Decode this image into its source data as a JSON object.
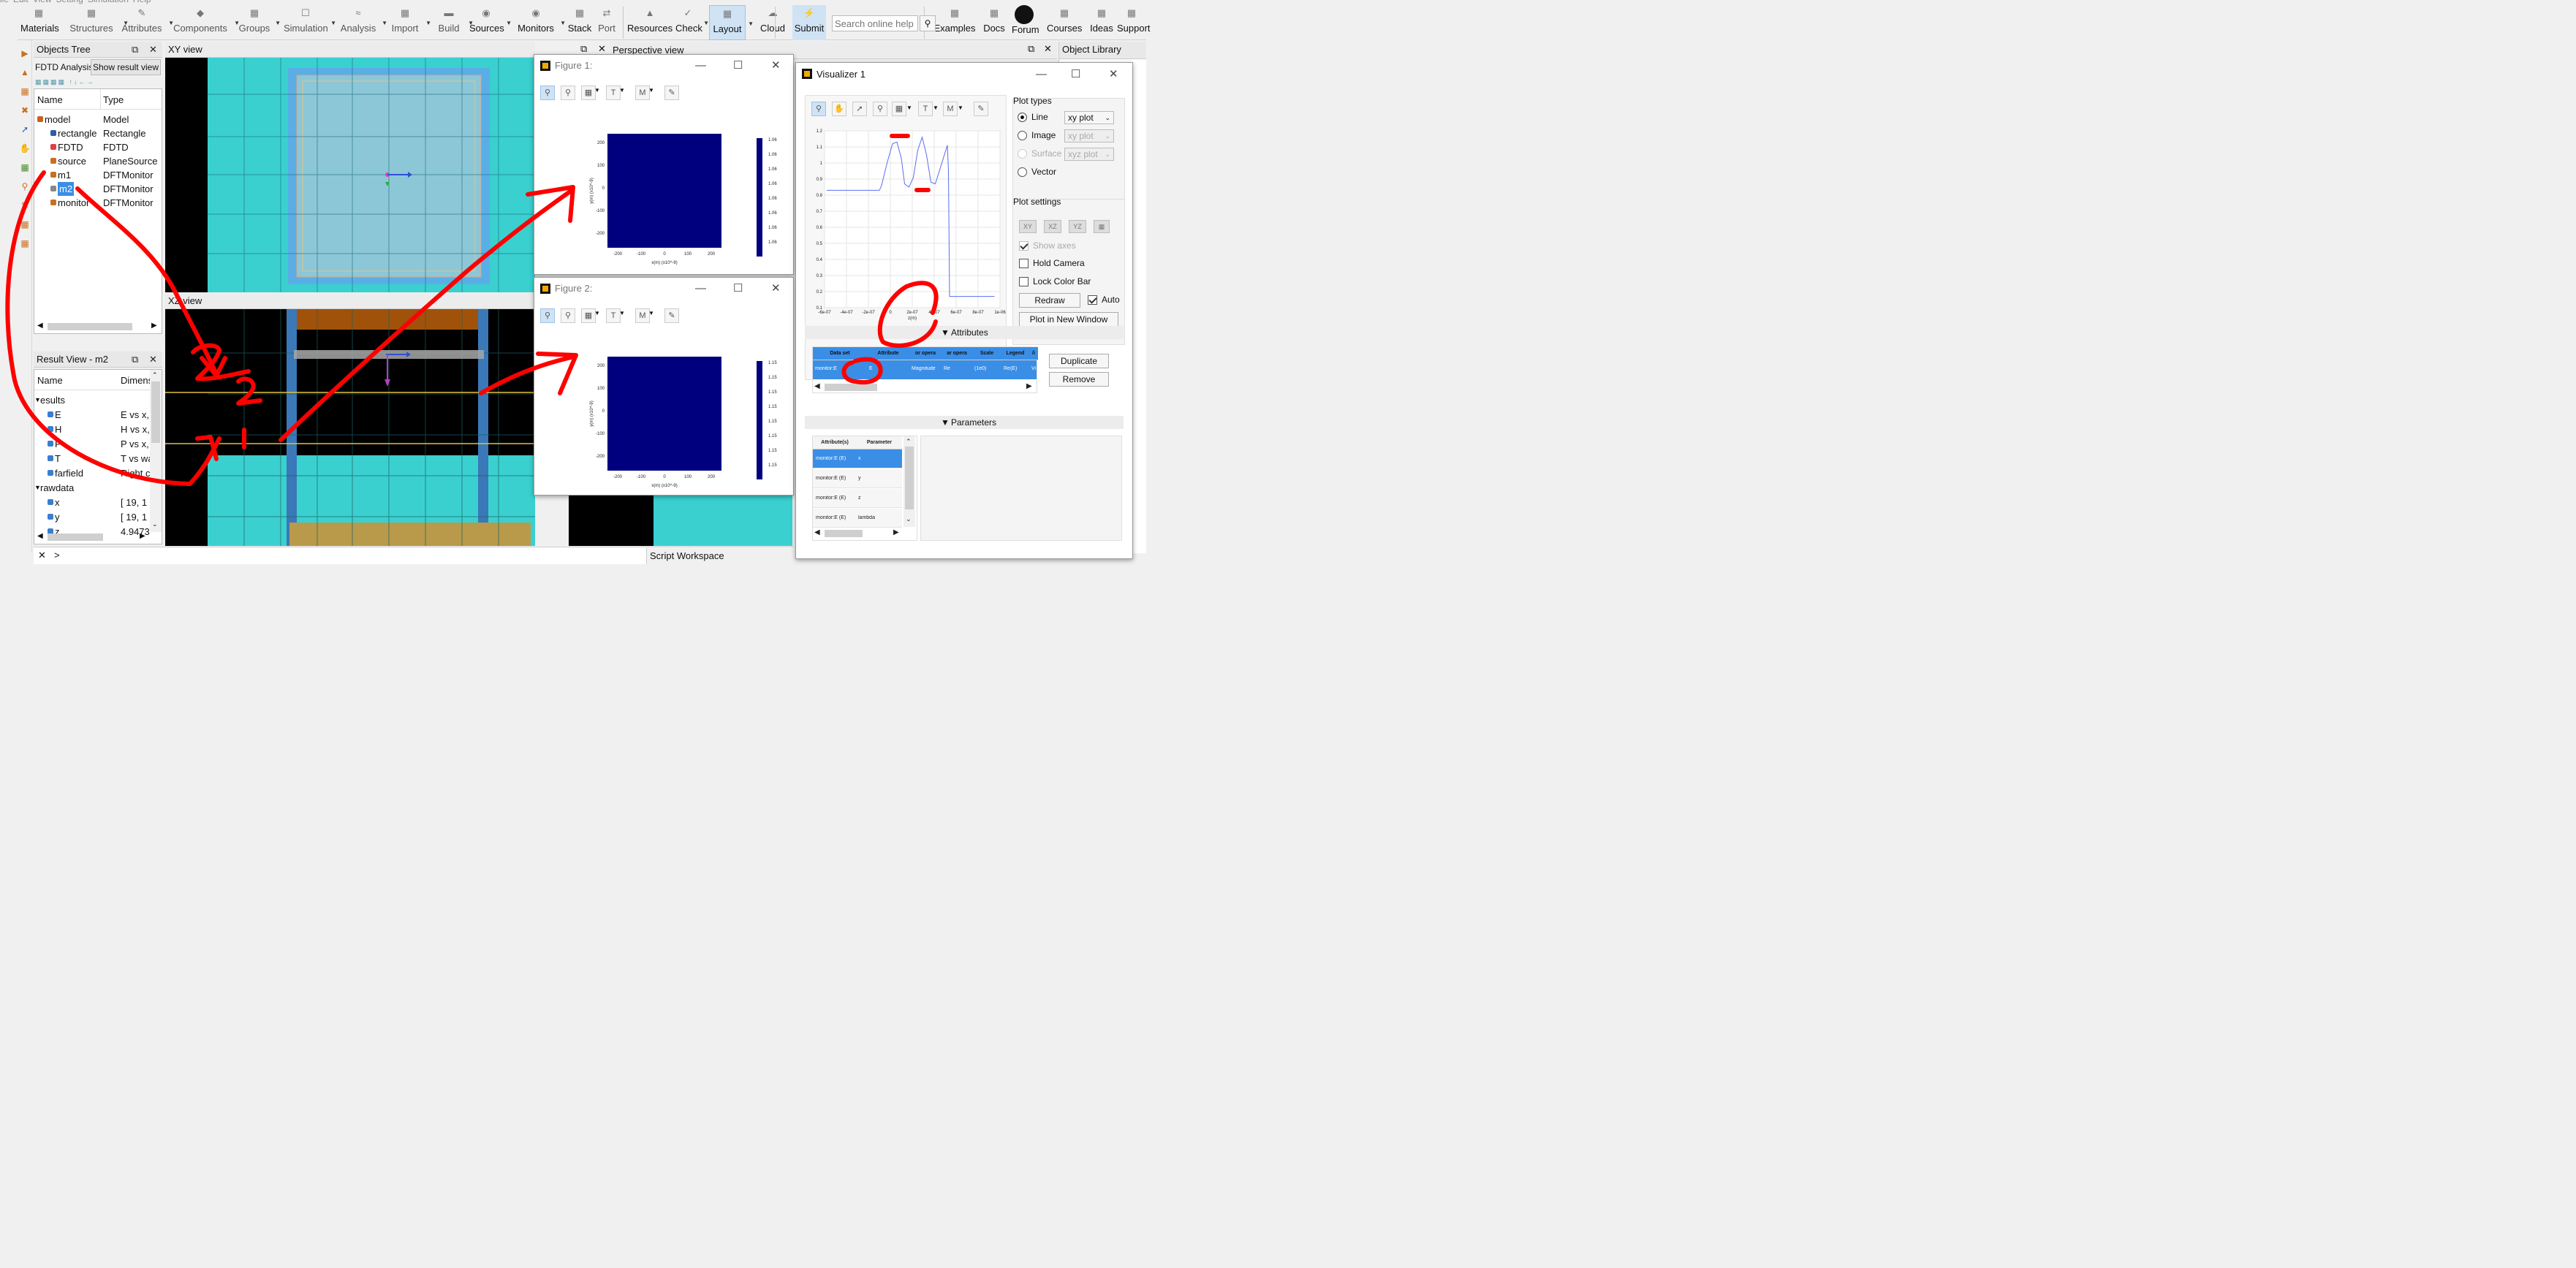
{
  "menubar": {
    "items": [
      "ile",
      "Edit",
      "View",
      "Setting",
      "Simulation",
      "Help"
    ]
  },
  "toolbar": {
    "items": [
      {
        "label": "Materials",
        "icon": "materials-icon"
      },
      {
        "label": "Structures",
        "icon": "structures-icon"
      },
      {
        "label": "Attributes",
        "icon": "attributes-icon"
      },
      {
        "label": "Components",
        "icon": "components-icon"
      },
      {
        "label": "Groups",
        "icon": "groups-icon"
      },
      {
        "label": "Simulation",
        "icon": "simulation-icon"
      },
      {
        "label": "Analysis",
        "icon": "analysis-icon"
      },
      {
        "label": "Import",
        "icon": "import-icon"
      },
      {
        "label": "Build",
        "icon": "build-icon"
      },
      {
        "label": "Sources",
        "icon": "sources-icon"
      },
      {
        "label": "Monitors",
        "icon": "monitors-icon"
      },
      {
        "label": "Stack",
        "icon": "stack-icon"
      },
      {
        "label": "Port",
        "icon": "port-icon"
      },
      {
        "label": "Resources",
        "icon": "resources-icon"
      },
      {
        "label": "Check",
        "icon": "check-icon"
      },
      {
        "label": "Layout",
        "icon": "layout-icon"
      },
      {
        "label": "Cloud",
        "icon": "cloud-icon"
      },
      {
        "label": "Submit",
        "icon": "submit-icon"
      },
      {
        "label": "Examples",
        "icon": "examples-icon"
      },
      {
        "label": "Docs",
        "icon": "docs-icon"
      },
      {
        "label": "Forum",
        "icon": "forum-icon"
      },
      {
        "label": "Courses",
        "icon": "courses-icon"
      },
      {
        "label": "Ideas",
        "icon": "ideas-icon"
      },
      {
        "label": "Support",
        "icon": "support-icon"
      }
    ],
    "search_placeholder": "Search online help"
  },
  "objects_tree": {
    "title": "Objects Tree",
    "tab_active": "FDTD Analysis",
    "tab_other": "Show result view",
    "col_name": "Name",
    "col_type": "Type",
    "rows": [
      {
        "name": "model",
        "type": "Model"
      },
      {
        "name": "rectangle",
        "type": "Rectangle"
      },
      {
        "name": "FDTD",
        "type": "FDTD"
      },
      {
        "name": "source",
        "type": "PlaneSource"
      },
      {
        "name": "m1",
        "type": "DFTMonitor"
      },
      {
        "name": "m2",
        "type": "DFTMonitor"
      },
      {
        "name": "monitor",
        "type": "DFTMonitor"
      }
    ]
  },
  "result_view": {
    "title": "Result View - m2",
    "col_name": "Name",
    "col_dims": "Dimens",
    "rows": [
      {
        "name": "esults",
        "dims": ""
      },
      {
        "name": "E",
        "dims": "E vs x,"
      },
      {
        "name": "H",
        "dims": "H vs x,"
      },
      {
        "name": "P",
        "dims": "P vs x,"
      },
      {
        "name": "T",
        "dims": "T vs wa"
      },
      {
        "name": "farfield",
        "dims": "Right c"
      },
      {
        "name": "rawdata",
        "dims": ""
      },
      {
        "name": "x",
        "dims": "[ 19, 1"
      },
      {
        "name": "y",
        "dims": "[ 19, 1"
      },
      {
        "name": "z",
        "dims": "4.9473"
      }
    ]
  },
  "views": {
    "xy": "XY view",
    "xz": "XZ view",
    "perspective": "Perspective view",
    "object_library": "Object Library",
    "script_workspace": "Script Workspace",
    "prompt": ">"
  },
  "annotations": {
    "label_1": "1",
    "label_2": "2"
  },
  "figure1": {
    "title": "Figure 1:",
    "xlabel": "x(m) (x10^-9)",
    "ylabel": "y(m) (x10^-9)",
    "xticks": [
      "-200",
      "-100",
      "0",
      "100",
      "200"
    ],
    "yticks": [
      "200",
      "100",
      "0",
      "-100",
      "-200"
    ],
    "cbar": [
      "1.06",
      "1.06",
      "1.06",
      "1.06",
      "1.06",
      "1.06",
      "1.06",
      "1.06"
    ]
  },
  "figure2": {
    "title": "Figure 2:",
    "xlabel": "x(m) (x10^-9)",
    "ylabel": "y(m) (x10^-9)",
    "xticks": [
      "-200",
      "-100",
      "0",
      "100",
      "200"
    ],
    "yticks": [
      "200",
      "100",
      "0",
      "-100",
      "-200"
    ],
    "cbar": [
      "1.15",
      "1.15",
      "1.15",
      "1.15",
      "1.15",
      "1.15",
      "1.15",
      "1.15"
    ]
  },
  "visualizer": {
    "title": "Visualizer 1",
    "plot_types_label": "Plot types",
    "types": [
      {
        "label": "Line",
        "select": "xy plot",
        "checked": true,
        "enabled": true
      },
      {
        "label": "Image",
        "select": "xy plot",
        "checked": false,
        "enabled": true
      },
      {
        "label": "Surface",
        "select": "xyz plot",
        "checked": false,
        "enabled": false
      },
      {
        "label": "Vector",
        "select": "",
        "checked": false,
        "enabled": true
      }
    ],
    "plot_settings_label": "Plot settings",
    "view_buttons": [
      "XY",
      "XZ",
      "YZ"
    ],
    "show_axes": "Show axes",
    "hold_camera": "Hold Camera",
    "lock_color_bar": "Lock Color Bar",
    "redraw": "Redraw",
    "auto": "Auto",
    "plot_new_window": "Plot in New Window",
    "attributes_label": "Attributes",
    "parameters_label": "Parameters",
    "duplicate": "Duplicate",
    "remove": "Remove",
    "attr_headers": [
      "Data set",
      "Attribute",
      "or opera",
      "ar opera",
      "Scale",
      "Legend",
      "/i"
    ],
    "attr_row": [
      "monitor:E",
      "E",
      "Magnitude",
      "Re",
      "(1e0)",
      "Re(E)",
      "Vi D"
    ],
    "param_headers": [
      "Attribute(s)",
      "Parameter"
    ],
    "param_rows": [
      [
        "monitor:E (E)",
        "x"
      ],
      [
        "monitor:E (E)",
        "y"
      ],
      [
        "monitor:E (E)",
        "z"
      ],
      [
        "monitor:E (E)",
        "lambda"
      ]
    ]
  },
  "chart_data": {
    "type": "line",
    "xlabel": "z(m)",
    "xticks": [
      "-6e-07",
      "-4e-07",
      "-2e-07",
      "0",
      "2e-07",
      "4e-07",
      "6e-07",
      "8e-07",
      "1e-06"
    ],
    "yticks": [
      "1.2",
      "1.1",
      "1",
      "0.9",
      "0.8",
      "0.7",
      "0.6",
      "0.5",
      "0.4",
      "0.3",
      "0.2",
      "0.1"
    ],
    "xlim": [
      -6e-07,
      1e-06
    ],
    "ylim": [
      0.1,
      1.2
    ],
    "series": [
      {
        "x": [
          -5.8e-07,
          -1e-07,
          -8e-08,
          -3e-08,
          2e-08,
          6e-08,
          1e-07,
          1.3e-07,
          1.7e-07,
          2.1e-07,
          2.5e-07,
          2.9e-07,
          3.3e-07,
          3.7e-07,
          4.1e-07,
          5.2e-07,
          5.3e-07,
          5.4e-07,
          5.7e-07,
          5.8e-07,
          8e-07,
          9.5e-07
        ],
        "y": [
          0.83,
          0.83,
          0.86,
          1.0,
          1.12,
          1.13,
          1.03,
          0.87,
          0.85,
          0.91,
          1.08,
          1.16,
          1.05,
          0.88,
          0.87,
          1.11,
          0.95,
          0.17,
          0.17,
          0.17,
          0.17,
          0.17
        ]
      }
    ]
  }
}
